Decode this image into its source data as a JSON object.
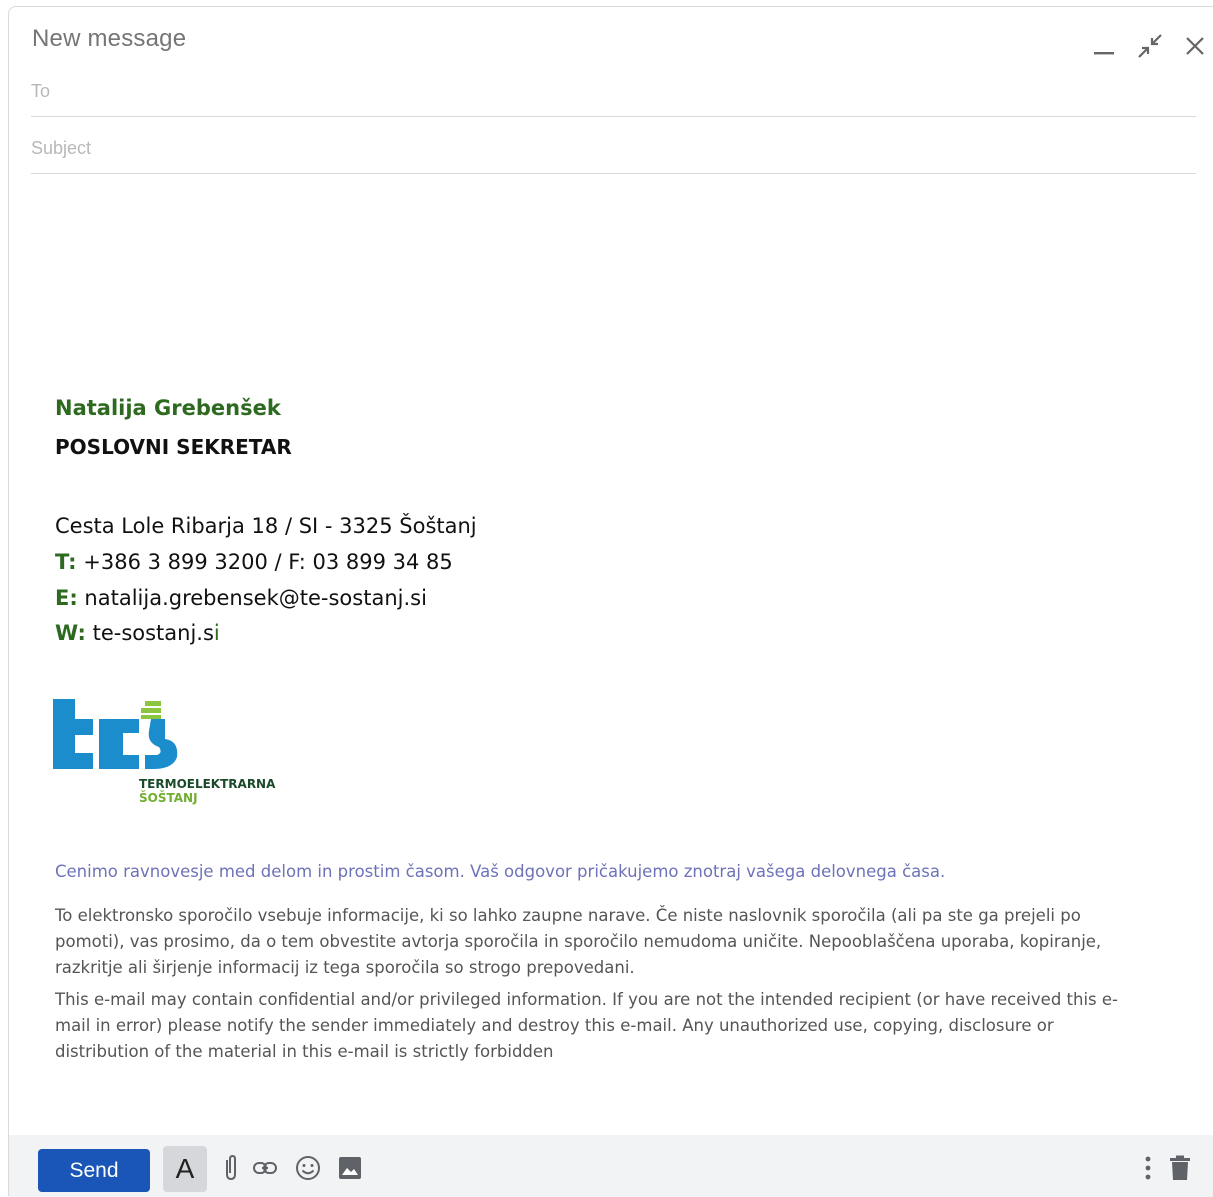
{
  "window": {
    "title": "New message"
  },
  "fields": {
    "to_placeholder": "To",
    "subject_placeholder": "Subject"
  },
  "signature": {
    "name": "Natalija Grebenšek",
    "role": "POSLOVNI SEKRETAR",
    "address": "Cesta Lole Ribarja 18 / SI - 3325 Šoštanj",
    "phone_label": "T:",
    "phone": " +386 3 899 3200 / F: 03 899 34 85",
    "email_label": "E:",
    "email": " natalija.grebensek@te-sostanj.si",
    "web_label": "W:",
    "web": " te-sostanj.s",
    "web_last": "i",
    "logo": {
      "line1": "TERMOELEKTRARNA",
      "line2": "ŠOŠTANJ",
      "blue": "#1b8ccc",
      "green": "#8cc63f"
    }
  },
  "notes": {
    "balance": "Cenimo ravnovesje med delom in prostim časom. Vaš odgovor pričakujemo znotraj vašega delovnega časa.",
    "disclaimer_sl": "To elektronsko sporočilo vsebuje informacije, ki so lahko zaupne narave. Če niste naslovnik sporočila (ali pa ste ga prejeli po pomoti), vas prosimo, da o tem obvestite avtorja sporočila in sporočilo nemudoma uničite. Nepooblaščena uporaba, kopiranje, razkritje ali širjenje informacij iz tega sporočila so strogo prepovedani.",
    "disclaimer_en": "This e-mail may contain confidential and/or privileged information. If you are not the intended recipient (or have received this e-mail in error) please notify the sender immediately and destroy this e-mail. Any unauthorized use, copying, disclosure or distribution of the material in this e-mail is strictly forbidden"
  },
  "toolbar": {
    "send_label": "Send",
    "format_label": "A",
    "icons": [
      "paperclip-icon",
      "link-icon",
      "emoji-icon",
      "image-icon",
      "more-vert-icon",
      "trash-icon"
    ]
  },
  "colors": {
    "send": "#1a56b8",
    "sig_green": "#2d6a1f",
    "balance_text": "#6e72b8"
  }
}
